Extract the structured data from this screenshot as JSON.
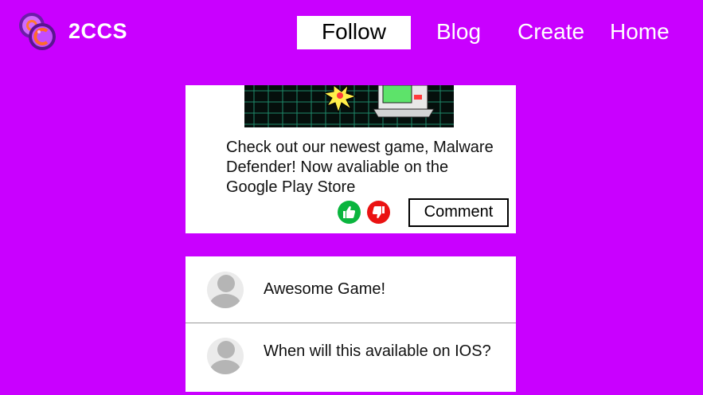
{
  "brand": {
    "name": "2CCS",
    "logo_icon": "coins-logo-icon"
  },
  "nav": {
    "items": [
      {
        "label": "Follow",
        "active": true
      },
      {
        "label": "Blog",
        "active": false
      },
      {
        "label": "Create",
        "active": false
      },
      {
        "label": "Home",
        "active": false
      }
    ]
  },
  "post": {
    "image_icon": "retro-computer-explosion-image",
    "text": "Check out our newest game, Malware Defender! Now avaliable on the Google Play Store",
    "like_icon": "thumbs-up-icon",
    "dislike_icon": "thumbs-down-icon",
    "comment_label": "Comment"
  },
  "comments": [
    {
      "avatar_icon": "user-avatar-icon",
      "text": "Awesome Game!"
    },
    {
      "avatar_icon": "user-avatar-icon",
      "text": "When will this available on IOS?"
    }
  ],
  "colors": {
    "background": "#c900ff",
    "like": "#0ab53e",
    "dislike": "#ea1212",
    "card": "#ffffff"
  }
}
